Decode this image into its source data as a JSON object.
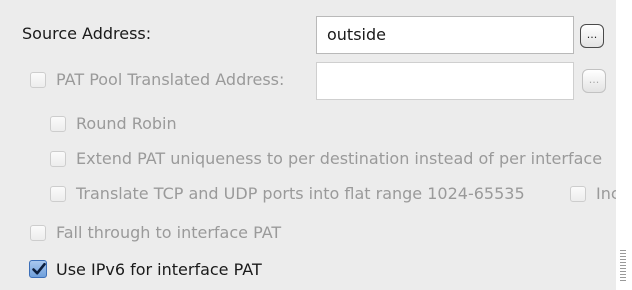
{
  "source_address": {
    "label": "Source Address:",
    "value": "outside",
    "browse_label": "..."
  },
  "pat_pool": {
    "label": "PAT Pool Translated Address:",
    "value": "",
    "browse_label": "...",
    "checked": false,
    "enabled": false
  },
  "round_robin": {
    "label": "Round Robin",
    "checked": false,
    "enabled": false
  },
  "extend_pat": {
    "label": "Extend PAT uniqueness to per destination instead of per interface",
    "checked": false,
    "enabled": false
  },
  "translate_tcp_udp": {
    "label": "Translate TCP and UDP ports into flat range 1024-65535",
    "checked": false,
    "enabled": false
  },
  "include_reserved": {
    "label": "Inc",
    "checked": false,
    "enabled": false
  },
  "fall_through": {
    "label": "Fall through to interface PAT",
    "checked": false,
    "enabled": false
  },
  "use_ipv6": {
    "label": "Use IPv6 for interface PAT",
    "checked": true,
    "enabled": true
  },
  "colors": {
    "panel_bg": "#ececec",
    "text_enabled": "#1a1a1a",
    "text_disabled": "#9a9a9a",
    "checkbox_checked": "#6f9fdb"
  }
}
